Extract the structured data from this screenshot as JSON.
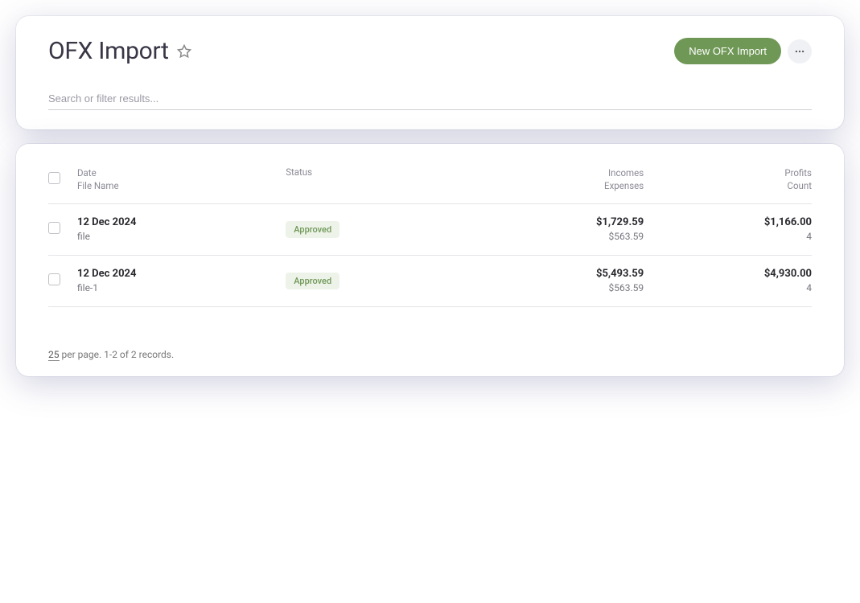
{
  "header": {
    "title": "OFX Import",
    "new_button_label": "New OFX Import"
  },
  "search": {
    "placeholder": "Search or filter results..."
  },
  "table": {
    "columns": {
      "date_label": "Date",
      "filename_label": "File Name",
      "status_label": "Status",
      "incomes_label": "Incomes",
      "expenses_label": "Expenses",
      "profits_label": "Profits",
      "count_label": "Count"
    },
    "rows": [
      {
        "date": "12 Dec 2024",
        "filename": "file",
        "status": "Approved",
        "incomes": "$1,729.59",
        "expenses": "$563.59",
        "profits": "$1,166.00",
        "count": "4"
      },
      {
        "date": "12 Dec 2024",
        "filename": "file-1",
        "status": "Approved",
        "incomes": "$5,493.59",
        "expenses": "$563.59",
        "profits": "$4,930.00",
        "count": "4"
      }
    ]
  },
  "pager": {
    "per_page": "25",
    "summary": " per page. 1-2 of 2 records."
  }
}
